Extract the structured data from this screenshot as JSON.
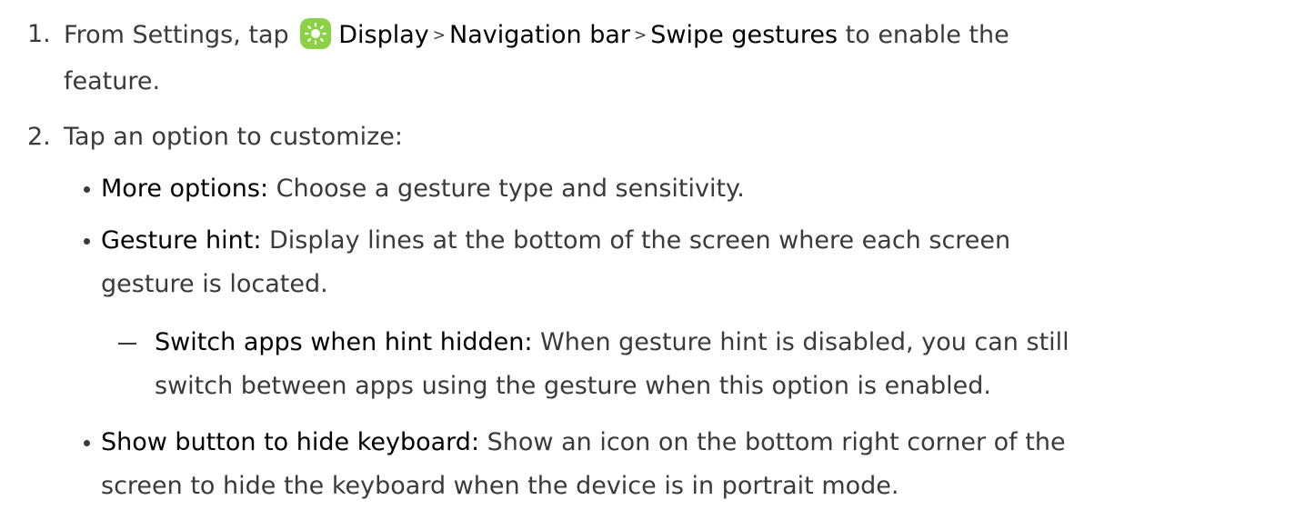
{
  "step1": {
    "number": "1.",
    "prefix": "From Settings, tap",
    "display": "Display",
    "sep1": ">",
    "navbar": "Navigation bar",
    "sep2": ">",
    "swipe": "Swipe gestures",
    "suffix": " to enable the",
    "cont": "feature.",
    "icon": "display-sun-icon",
    "icon_color": "#8bd145"
  },
  "step2": {
    "number": "2.",
    "text": "Tap an option to customize:"
  },
  "options": {
    "more": {
      "label": "More options",
      "colon": ":",
      "desc": " Choose a gesture type and sensitivity."
    },
    "hint": {
      "label": "Gesture hint",
      "colon": ":",
      "desc": " Display lines at the bottom of the screen where each screen",
      "cont": "gesture is located."
    },
    "switch": {
      "label": "Switch apps when hint hidden",
      "colon": ":",
      "desc": " When gesture hint is disabled, you can still",
      "cont": "switch between apps using the gesture when this option is enabled."
    },
    "keyboard": {
      "label": "Show button to hide keyboard",
      "colon": ":",
      "desc": " Show an icon on the bottom right corner of the",
      "cont": "screen to hide the keyboard when the device is in portrait mode."
    }
  }
}
